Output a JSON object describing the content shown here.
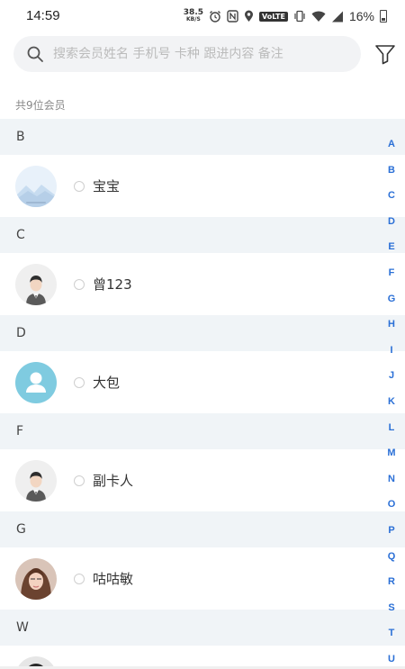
{
  "status_bar": {
    "time": "14:59",
    "net_speed_value": "38.5",
    "net_speed_unit": "KB/S",
    "volte": "VoLTE",
    "battery": "16%"
  },
  "search": {
    "placeholder": "搜索会员姓名 手机号 卡种 跟进内容 备注",
    "value": ""
  },
  "member_count": "共9位会员",
  "sections": [
    {
      "letter": "B",
      "members": [
        {
          "name": "宝宝",
          "avatar": "landscape-placeholder"
        }
      ]
    },
    {
      "letter": "C",
      "members": [
        {
          "name": "曾123",
          "avatar": "man-in-suit"
        }
      ]
    },
    {
      "letter": "D",
      "members": [
        {
          "name": "大包",
          "avatar": "default-user"
        }
      ]
    },
    {
      "letter": "F",
      "members": [
        {
          "name": "副卡人",
          "avatar": "man-in-suit"
        }
      ]
    },
    {
      "letter": "G",
      "members": [
        {
          "name": "咕咕敏",
          "avatar": "woman-photo"
        }
      ]
    },
    {
      "letter": "W",
      "members": []
    }
  ],
  "index_letters": [
    "A",
    "B",
    "C",
    "D",
    "E",
    "F",
    "G",
    "H",
    "I",
    "J",
    "K",
    "L",
    "M",
    "N",
    "O",
    "P",
    "Q",
    "R",
    "S",
    "T",
    "U"
  ],
  "colors": {
    "index_accent": "#2a6fd6",
    "section_bg": "#f0f4f7",
    "search_bg": "#f2f3f5",
    "default_avatar": "#7fcbe0"
  }
}
